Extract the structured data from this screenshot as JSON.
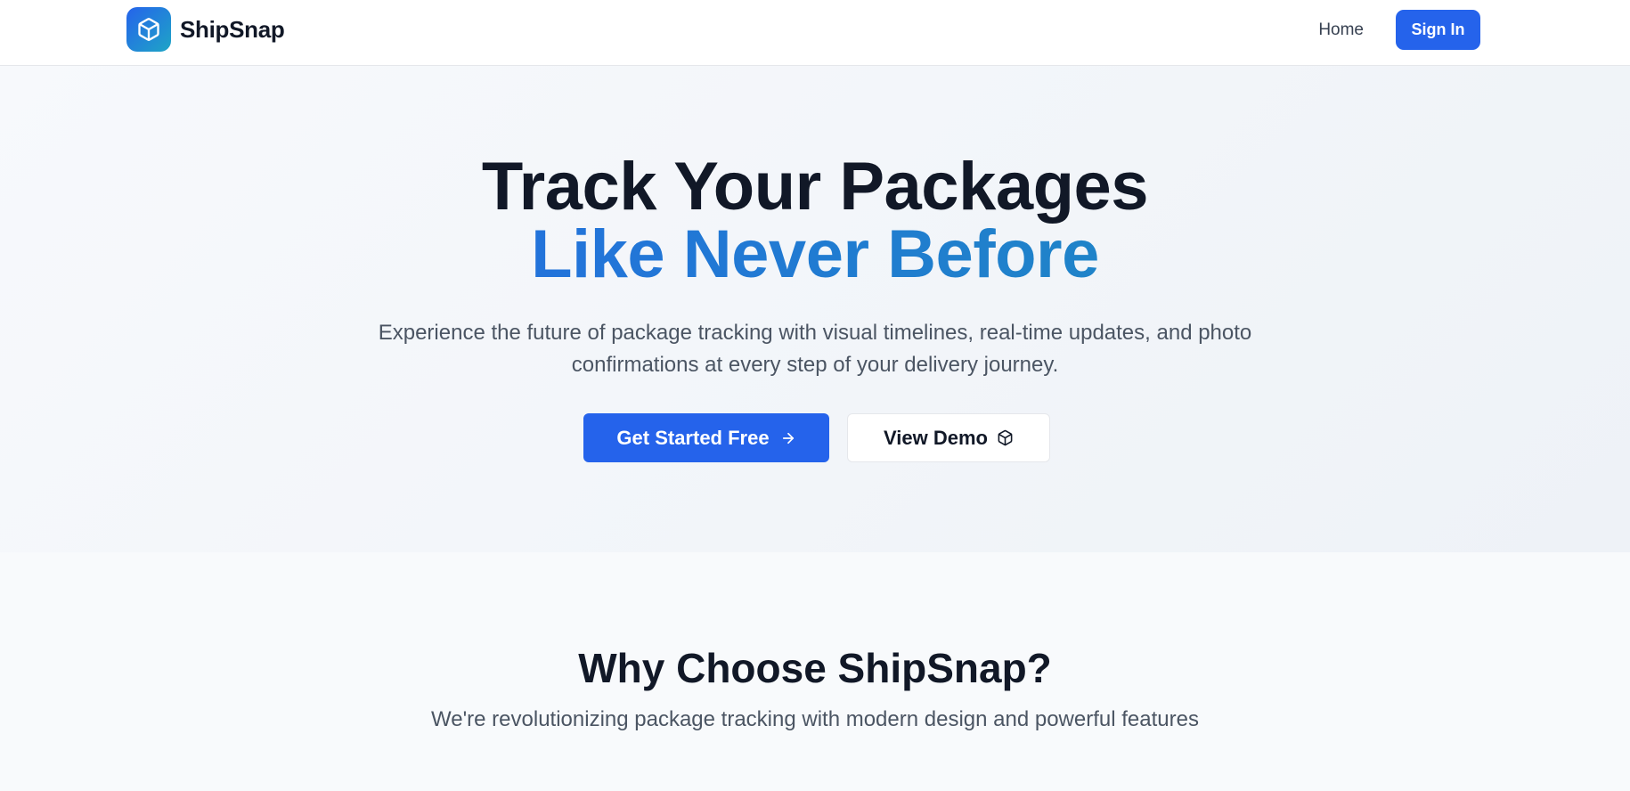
{
  "brand": {
    "name": "ShipSnap",
    "logo_icon": "package-icon",
    "logo_gradient": [
      "#2563eb",
      "#1ea5c6"
    ]
  },
  "nav": {
    "home_label": "Home",
    "signin_label": "Sign In"
  },
  "hero": {
    "title_line1": "Track Your Packages",
    "title_line2": "Like Never Before",
    "subtitle": "Experience the future of package tracking with visual timelines, real-time updates, and photo confirmations at every step of your delivery journey.",
    "primary_cta": "Get Started Free",
    "primary_cta_icon": "arrow-right-icon",
    "secondary_cta": "View Demo",
    "secondary_cta_icon": "package-icon"
  },
  "features": {
    "title": "Why Choose ShipSnap?",
    "subtitle": "We're revolutionizing package tracking with modern design and powerful features"
  },
  "colors": {
    "accent": "#2563eb",
    "text_dark": "#111827",
    "text_muted": "#4b5563"
  }
}
